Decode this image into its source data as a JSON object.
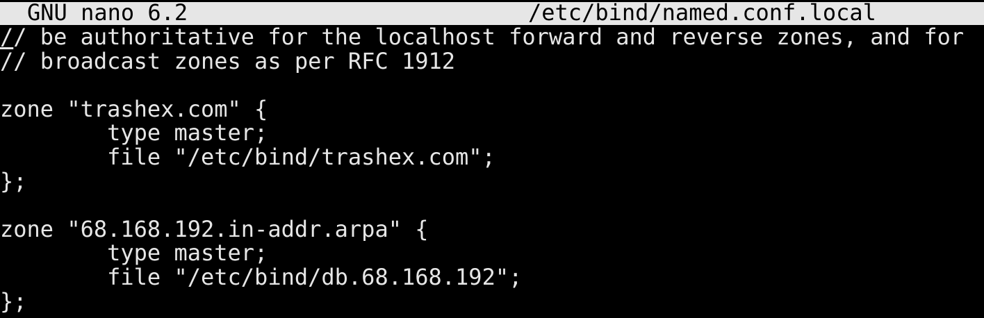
{
  "titlebar": {
    "app_name": "GNU nano 6.2",
    "file_path": "/etc/bind/named.conf.local"
  },
  "editor": {
    "cursor_char": "/",
    "first_line_rest": "/ be authoritative for the localhost forward and reverse zones, and for",
    "lines": [
      "// broadcast zones as per RFC 1912",
      "",
      "zone \"trashex.com\" {",
      "        type master;",
      "        file \"/etc/bind/trashex.com\";",
      "};",
      "",
      "zone \"68.168.192.in-addr.arpa\" {",
      "        type master;",
      "        file \"/etc/bind/db.68.168.192\";",
      "};"
    ]
  },
  "colors": {
    "background": "#000000",
    "foreground": "#e6e6e6",
    "titlebar_bg": "#e6e6e6",
    "titlebar_fg": "#000000"
  }
}
